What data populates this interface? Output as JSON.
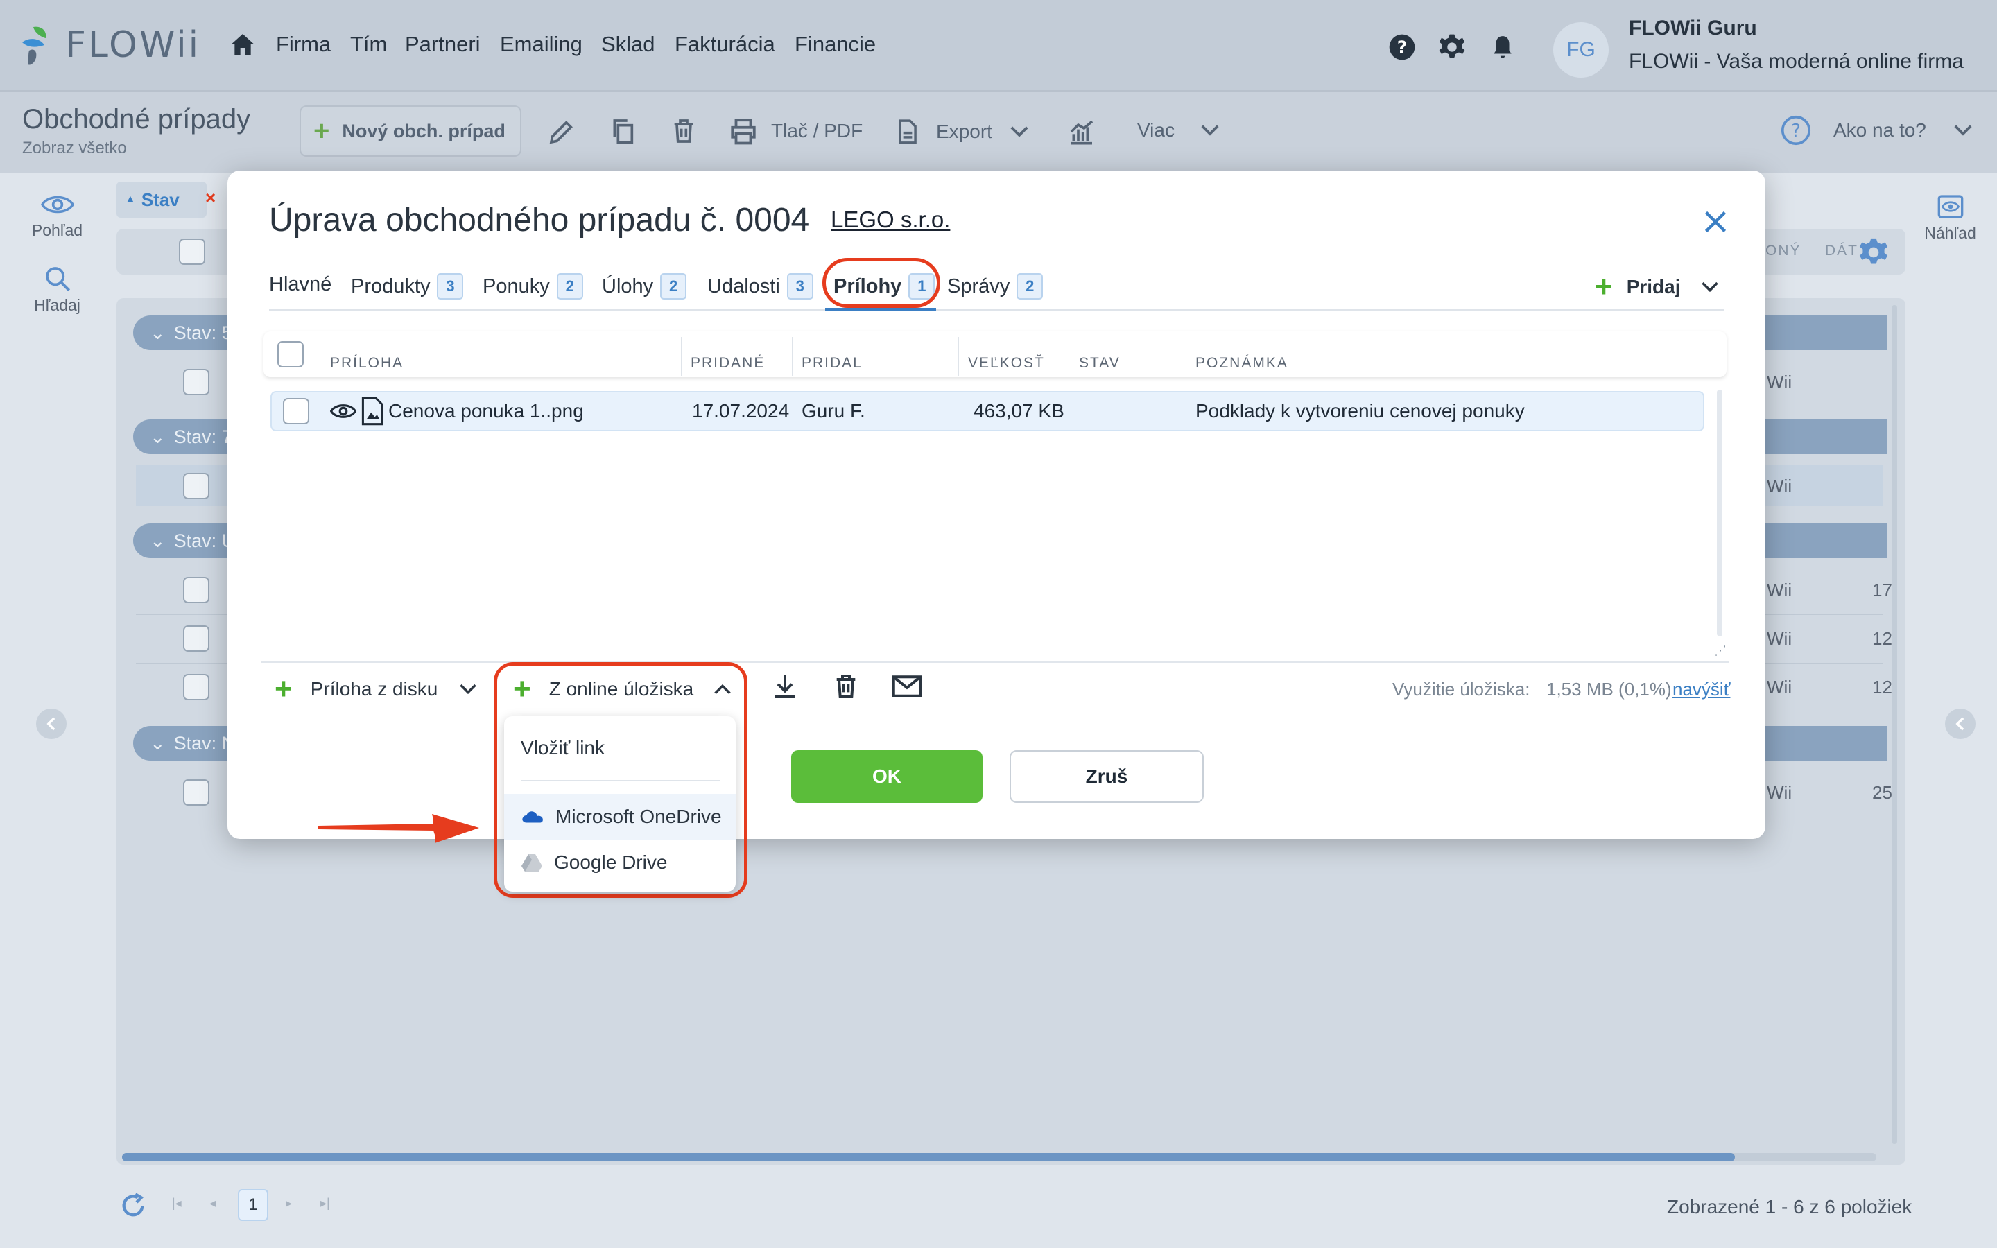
{
  "app": {
    "logo_text": "FLOWii"
  },
  "nav": {
    "items": [
      "Firma",
      "Tím",
      "Partneri",
      "Emailing",
      "Sklad",
      "Fakturácia",
      "Financie"
    ]
  },
  "user": {
    "initials": "FG",
    "name": "FLOWii Guru",
    "company": "FLOWii - Vaša moderná online firma"
  },
  "page": {
    "title": "Obchodné prípady",
    "subtitle": "Zobraz všetko"
  },
  "toolbar": {
    "new_label": "Nový obch. prípad",
    "print_label": "Tlač / PDF",
    "export_label": "Export",
    "more_label": "Viac",
    "help_label": "Ako na to?"
  },
  "sidebar": {
    "view_label": "Pohľad",
    "search_label": "Hľadaj"
  },
  "rightbar": {
    "preview_label": "Náhľad"
  },
  "filter": {
    "chip_label": "Stav",
    "col_right_1": "ONÝ",
    "col_right_2": "DÁT"
  },
  "groups": [
    {
      "label": "Stav: 5",
      "rows": [
        {
          "right": "Wii",
          "num": ""
        }
      ]
    },
    {
      "label": "Stav: 7",
      "rows": [
        {
          "right": "Wii",
          "num": ""
        }
      ]
    },
    {
      "label": "Stav: U",
      "rows": [
        {
          "right": "Wii",
          "num": "17"
        },
        {
          "right": "Wii",
          "num": "12"
        },
        {
          "right": "Wii",
          "num": "12"
        }
      ]
    },
    {
      "label": "Stav: N",
      "rows": [
        {
          "right": "Wii",
          "num": "25"
        }
      ]
    }
  ],
  "modal": {
    "title": "Úprava obchodného prípadu č. 0004",
    "company": "LEGO s.r.o.",
    "tabs": [
      {
        "label": "Hlavné",
        "count": ""
      },
      {
        "label": "Produkty",
        "count": "3"
      },
      {
        "label": "Ponuky",
        "count": "2"
      },
      {
        "label": "Úlohy",
        "count": "2"
      },
      {
        "label": "Udalosti",
        "count": "3"
      },
      {
        "label": "Prílohy",
        "count": "1"
      },
      {
        "label": "Správy",
        "count": "2"
      }
    ],
    "add_label": "Pridaj",
    "columns": [
      "PRÍLOHA",
      "PRIDANÉ",
      "PRIDAL",
      "VEĽKOSŤ",
      "STAV",
      "POZNÁMKA"
    ],
    "rows": [
      {
        "file": "Cenova ponuka 1..png",
        "added": "17.07.2024",
        "by": "Guru F.",
        "size": "463,07 KB",
        "status": "",
        "note": "Podklady k vytvoreniu cenovej ponuky"
      }
    ],
    "footer": {
      "disk_label": "Príloha z disku",
      "online_label": "Z online úložiska",
      "storage_label": "Využitie úložiska:",
      "storage_value": "1,53 MB (0,1%)",
      "increase_label": "navýšiť"
    },
    "ok_label": "OK",
    "cancel_label": "Zruš",
    "dropdown": {
      "link_label": "Vložiť link",
      "onedrive_label": "Microsoft OneDrive",
      "gdrive_label": "Google Drive"
    }
  },
  "paging": {
    "page": "1",
    "summary": "Zobrazené 1 - 6 z 6 položiek"
  },
  "colors": {
    "accent": "#3b7fc4",
    "ok": "#5bbd3a",
    "highlight": "#e63c1e",
    "plus": "#4caf2f"
  }
}
